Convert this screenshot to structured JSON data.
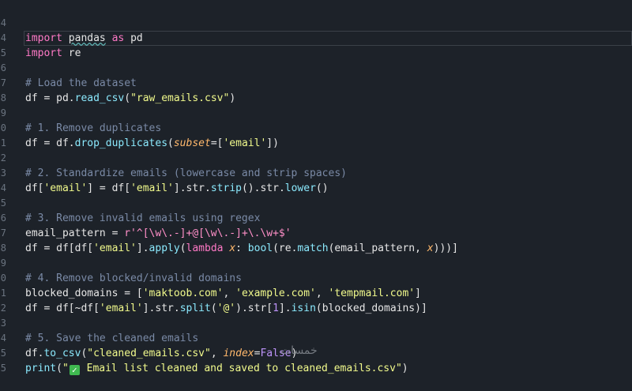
{
  "editor": {
    "line_numbers": [
      "4",
      "4",
      "5",
      "6",
      "7",
      "8",
      "9",
      "0",
      "1",
      "2",
      "3",
      "4",
      "5",
      "6",
      "7",
      "8",
      "9",
      "0",
      "1",
      "2",
      "3",
      "4",
      "5"
    ],
    "lines": {
      "l1": {
        "kw1": "import",
        "sp1": " ",
        "mod": "pandas",
        "sp2": " ",
        "kw2": "as",
        "sp3": " ",
        "alias": "pd"
      },
      "l2": {
        "kw1": "import",
        "sp1": " ",
        "mod": "re"
      },
      "l4": {
        "text": "# Load the dataset"
      },
      "l5": {
        "a": "df = pd.",
        "fn": "read_csv",
        "b": "(",
        "s": "\"raw_emails.csv\"",
        "c": ")"
      },
      "l7": {
        "text": "# 1. Remove duplicates"
      },
      "l8": {
        "a": "df = df.",
        "fn": "drop_duplicates",
        "b": "(",
        "p": "subset",
        "c": "=[",
        "s": "'email'",
        "d": "])"
      },
      "l10": {
        "text": "# 2. Standardize emails (lowercase and strip spaces)"
      },
      "l11": {
        "a": "df[",
        "s1": "'email'",
        "b": "] = df[",
        "s2": "'email'",
        "c": "].str.",
        "fn1": "strip",
        "d": "().str.",
        "fn2": "lower",
        "e": "()"
      },
      "l13": {
        "text": "# 3. Remove invalid emails using regex"
      },
      "l14": {
        "a": "email_pattern = ",
        "r": "r'^[\\w\\.-]+@[\\w\\.-]+\\.\\w+$'"
      },
      "l15": {
        "a": "df = df[df[",
        "s": "'email'",
        "b": "].",
        "fn1": "apply",
        "c": "(",
        "kw": "lambda",
        "sp": " ",
        "x1": "x",
        "d": ": ",
        "fn2": "bool",
        "e": "(re.",
        "fn3": "match",
        "f": "(email_pattern, ",
        "x2": "x",
        "g": ")))]"
      },
      "l17": {
        "text": "# 4. Remove blocked/invalid domains"
      },
      "l18": {
        "a": "blocked_domains = [",
        "s1": "'maktoob.com'",
        "b": ", ",
        "s2": "'example.com'",
        "c": ", ",
        "s3": "'tempmail.com'",
        "d": "]"
      },
      "l19": {
        "a": "df = df[~df[",
        "s1": "'email'",
        "b": "].str.",
        "fn1": "split",
        "c": "(",
        "s2": "'@'",
        "d": ").str[",
        "n": "1",
        "e": "].",
        "fn2": "isin",
        "f": "(blocked_domains)]"
      },
      "l21": {
        "text": "# 5. Save the cleaned emails"
      },
      "l22": {
        "a": "df.",
        "fn": "to_csv",
        "b": "(",
        "s": "\"cleaned_emails.csv\"",
        "c": ", ",
        "p": "index",
        "d": "=",
        "k": "False",
        "e": ")"
      },
      "l23": {
        "fn": "print",
        "a": "(",
        "s1": "\"",
        "chk": "✓",
        "s2": " Email list cleaned and saved to cleaned_emails.csv\"",
        "b": ")"
      }
    }
  },
  "watermark": "خمسات",
  "colors": {
    "background": "#1d2229",
    "keyword": "#ff79c6",
    "function": "#8be9fd",
    "string": "#f1fa8c",
    "comment": "#7a8aa6"
  }
}
